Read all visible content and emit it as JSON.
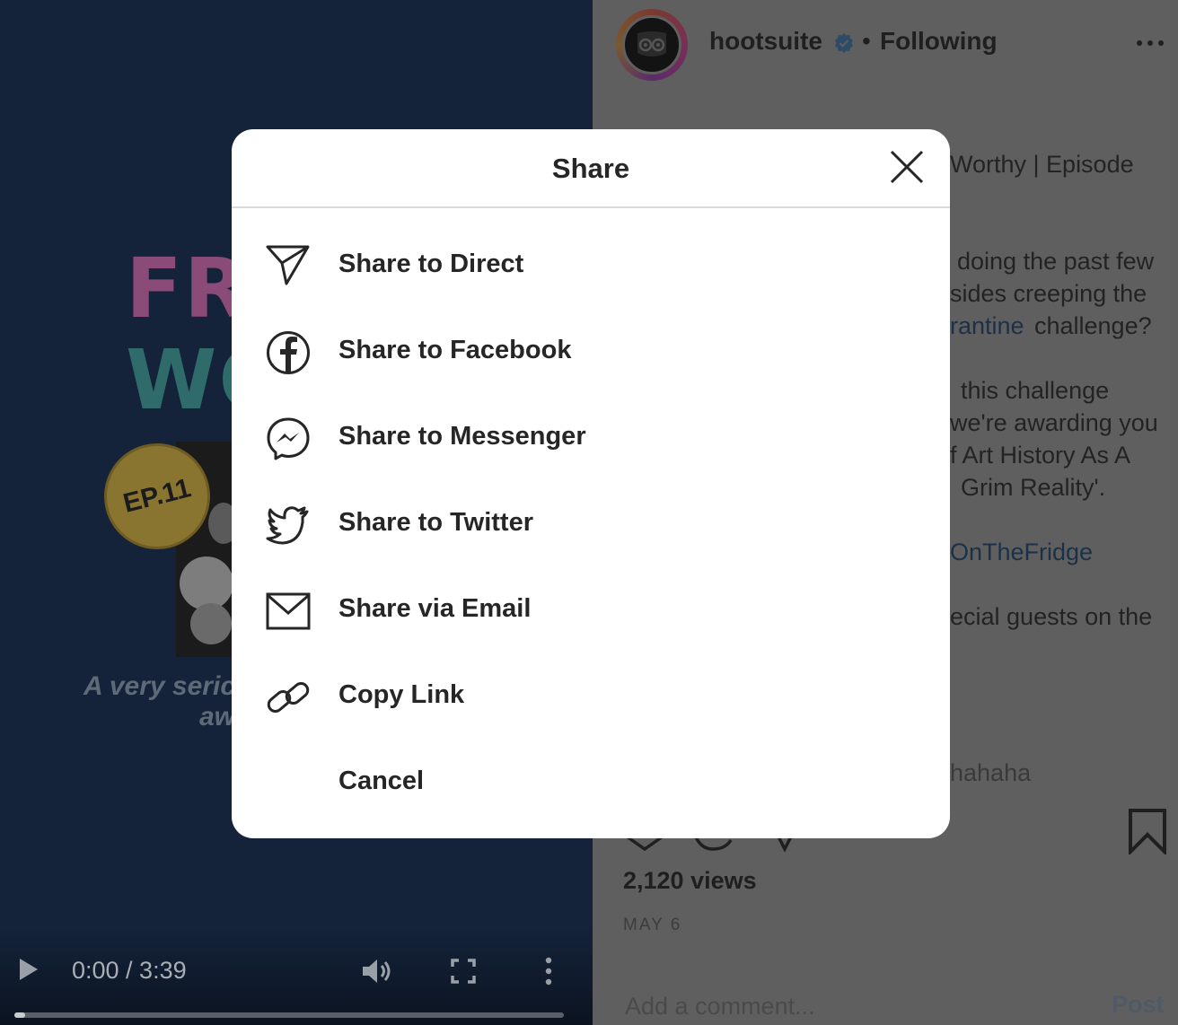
{
  "video": {
    "poster_title_line1": "FR",
    "poster_title_line2": "WO",
    "episode_badge": "EP.11",
    "tagline": "A very seric aw",
    "current_time": "0:00 / 3:39",
    "progress": 0.02
  },
  "post": {
    "username": "hootsuite",
    "separator": "•",
    "follow_status": "Following",
    "caption_lines": [
      {
        "text": "Worthy | Episode",
        "link": false
      },
      {
        "text": "doing the past few",
        "link": false
      },
      {
        "text": "sides creeping the",
        "link": false
      },
      {
        "text": "rantine",
        "link": true
      },
      {
        "text": "challenge?",
        "link": false
      },
      {
        "text": "this challenge",
        "link": false
      },
      {
        "text": "we're awarding you",
        "link": false
      },
      {
        "text": "f Art History As A",
        "link": false
      },
      {
        "text": "Grim Reality'.",
        "link": false
      },
      {
        "text": "OnTheFridge",
        "link": true
      },
      {
        "text": "ecial guests on the",
        "link": false
      },
      {
        "text": "hahaha",
        "link": false
      }
    ],
    "views": "2,120 views",
    "date": "MAY 6",
    "comment_placeholder": "Add a comment...",
    "post_label": "Post"
  },
  "share_modal": {
    "title": "Share",
    "items": [
      {
        "label": "Share to Direct",
        "icon": "paper-plane-icon"
      },
      {
        "label": "Share to Facebook",
        "icon": "facebook-icon"
      },
      {
        "label": "Share to Messenger",
        "icon": "messenger-icon"
      },
      {
        "label": "Share to Twitter",
        "icon": "twitter-icon"
      },
      {
        "label": "Share via Email",
        "icon": "email-icon"
      },
      {
        "label": "Copy Link",
        "icon": "link-icon"
      }
    ],
    "cancel_label": "Cancel"
  },
  "colors": {
    "modal_bg": "#ffffff",
    "text_primary": "#262626",
    "divider": "#dbdbdb",
    "video_bg": "#14233a",
    "panel_dim": "#5f5f5f"
  }
}
